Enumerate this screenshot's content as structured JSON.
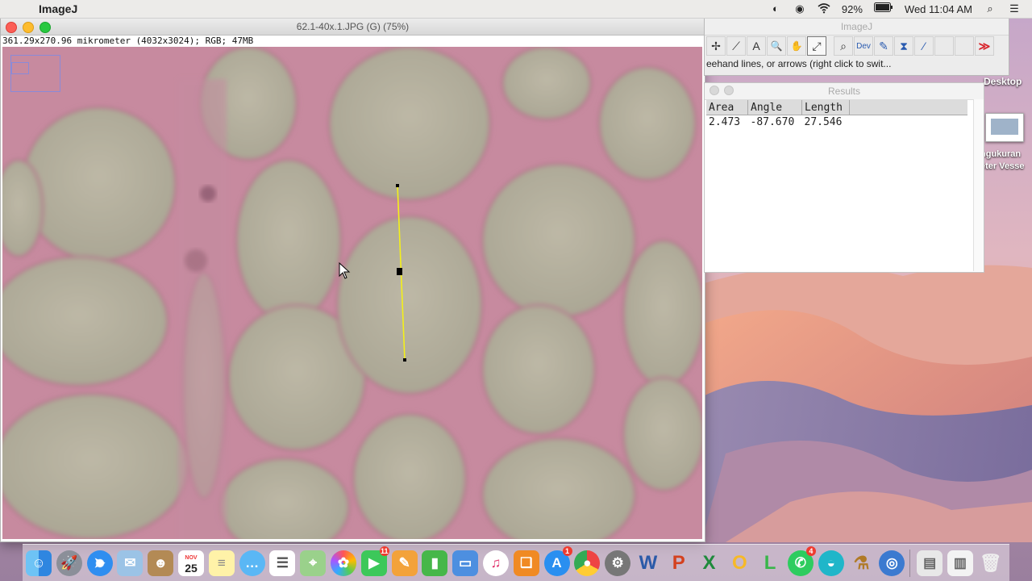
{
  "menubar": {
    "app_name": "ImageJ",
    "battery": "92%",
    "clock": "Wed 11:04 AM"
  },
  "image_window": {
    "title": "62.1-40x.1.JPG (G) (75%)",
    "info": "361.29x270.96 mikrometer (4032x3024); RGB; 47MB"
  },
  "imagej_window": {
    "title": "ImageJ",
    "status": "eehand lines, or arrows (right click to swit...",
    "tools": [
      {
        "icon": "multipoint-icon",
        "glyph": "✢"
      },
      {
        "icon": "wand-icon",
        "glyph": "⟋"
      },
      {
        "icon": "text-tool-icon",
        "glyph": "A"
      },
      {
        "icon": "magnifier-icon",
        "glyph": "🔍"
      },
      {
        "icon": "hand-icon",
        "glyph": "✋"
      },
      {
        "icon": "color-picker-icon",
        "glyph": "⤢"
      },
      {
        "icon": "zoom-icon",
        "glyph": "⌕"
      },
      {
        "icon": "dev-icon",
        "glyph": "Dev"
      },
      {
        "icon": "brush-icon",
        "glyph": "✎"
      },
      {
        "icon": "flood-fill-icon",
        "glyph": "⧗"
      },
      {
        "icon": "pipette-icon",
        "glyph": "⁄"
      },
      {
        "icon": "blank-tool-icon",
        "glyph": ""
      },
      {
        "icon": "blank-tool-icon",
        "glyph": ""
      },
      {
        "icon": "more-tools-icon",
        "glyph": "≫"
      }
    ]
  },
  "results": {
    "title": "Results",
    "columns": [
      "Area",
      "Angle",
      "Length"
    ],
    "rows": [
      [
        "2.473",
        "-87.670",
        "27.546"
      ]
    ]
  },
  "desktop": {
    "folder_label": "Desktop",
    "file_label_line1": "ngukuran",
    "file_label_line2": "eter Vesse"
  },
  "dock": {
    "calendar_month": "NOV",
    "calendar_day": "25",
    "badges": {
      "facetime": "11",
      "appstore": "1",
      "whatsapp": "4"
    }
  }
}
